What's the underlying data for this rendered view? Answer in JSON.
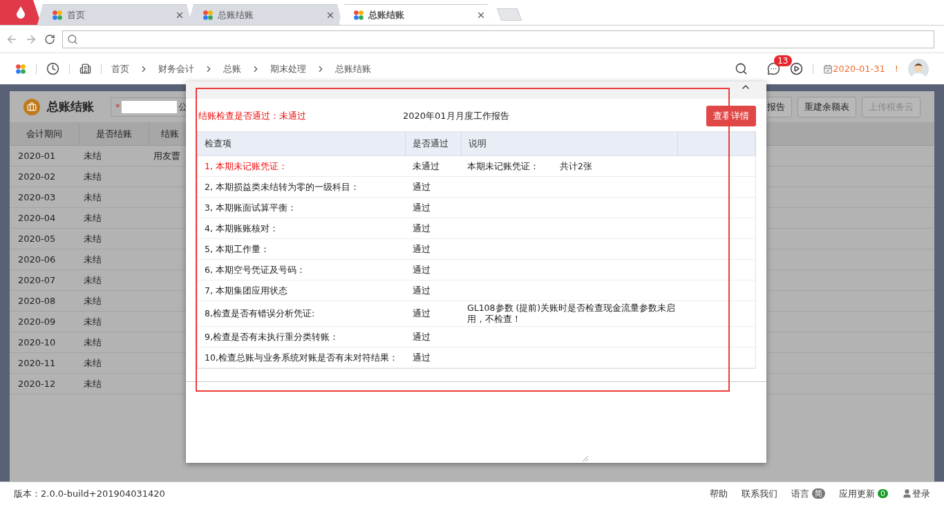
{
  "browser_tabs": [
    {
      "label": "首页",
      "selected": false
    },
    {
      "label": "总账结账",
      "selected": false
    },
    {
      "label": "总账结账",
      "selected": true
    }
  ],
  "breadcrumb": [
    "首页",
    "财务会计",
    "总账",
    "期末处理",
    "总账结账"
  ],
  "header": {
    "message_count": "13",
    "date": "2020-01-31",
    "alert": "!"
  },
  "page": {
    "title": "总账结账",
    "required_mark": "*",
    "company_label": "公",
    "buttons": [
      {
        "label": "报告",
        "disabled": false
      },
      {
        "label": "重建余额表",
        "disabled": false
      },
      {
        "label": "上传税务云",
        "disabled": true
      }
    ],
    "columns": [
      "会计期间",
      "是否结账",
      "结账"
    ],
    "rows": [
      {
        "period": "2020-01",
        "closed": "未结",
        "by": "用友曹"
      },
      {
        "period": "2020-02",
        "closed": "未结"
      },
      {
        "period": "2020-03",
        "closed": "未结"
      },
      {
        "period": "2020-04",
        "closed": "未结"
      },
      {
        "period": "2020-05",
        "closed": "未结"
      },
      {
        "period": "2020-06",
        "closed": "未结"
      },
      {
        "period": "2020-07",
        "closed": "未结"
      },
      {
        "period": "2020-08",
        "closed": "未结"
      },
      {
        "period": "2020-09",
        "closed": "未结"
      },
      {
        "period": "2020-10",
        "closed": "未结"
      },
      {
        "period": "2020-11",
        "closed": "未结"
      },
      {
        "period": "2020-12",
        "closed": "未结"
      }
    ]
  },
  "dialog": {
    "status": "结账检查是否通过：未通过",
    "report_title": "2020年01月月度工作报告",
    "detail_button": "查看详情",
    "columns": [
      "检查项",
      "是否通过",
      "说明"
    ],
    "checks": [
      {
        "item": "1, 本期未记账凭证：",
        "result": "未通过",
        "note": "本期未记账凭证：",
        "extra": "共计2张",
        "passed": false
      },
      {
        "item": "2, 本期损益类未结转为零的一级科目：",
        "result": "通过",
        "passed": true
      },
      {
        "item": "3, 本期账面试算平衡：",
        "result": "通过",
        "passed": true
      },
      {
        "item": "4, 本期账账核对：",
        "result": "通过",
        "passed": true
      },
      {
        "item": "5, 本期工作量：",
        "result": "通过",
        "passed": true
      },
      {
        "item": "6, 本期空号凭证及号码：",
        "result": "通过",
        "passed": true
      },
      {
        "item": "7, 本期集团应用状态",
        "result": "通过",
        "passed": true
      },
      {
        "item": "8,检查是否有错误分析凭证:",
        "result": "通过",
        "note": "GL108参数 (提前)关账时是否检查现金流量参数未启用，不检查！",
        "passed": true
      },
      {
        "item": "9,检查是否有未执行重分类转账：",
        "result": "通过",
        "passed": true
      },
      {
        "item": "10,检查总账与业务系统对账是否有未对符结果：",
        "result": "通过",
        "passed": true
      }
    ]
  },
  "status_bar": {
    "version": "版本：2.0.0-build+201904031420",
    "help": "帮助",
    "contact": "联系我们",
    "language_label": "语言",
    "language": "简",
    "updates_label": "应用更新",
    "updates_count": "0",
    "login": "登录"
  }
}
